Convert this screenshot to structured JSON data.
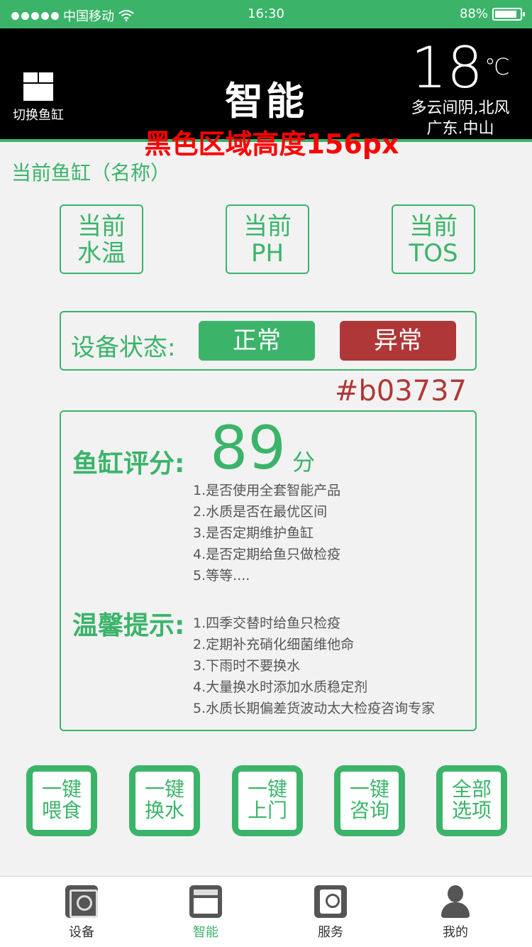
{
  "status_bar": {
    "carrier": "中国移动",
    "time": "16:30",
    "battery": "88%"
  },
  "header": {
    "switch_label": "切换鱼缸",
    "title": "智能",
    "temperature": "18",
    "temperature_unit": "℃",
    "weather_desc": "多云间阴,北风",
    "location": "广东.中山"
  },
  "annotations": {
    "header_note": "黑色区域高度156px",
    "color_note": "#b03737"
  },
  "tank_name": "当前鱼缸（名称）",
  "metrics": [
    {
      "line1": "当前",
      "line2": "水温"
    },
    {
      "line1": "当前",
      "line2": "PH"
    },
    {
      "line1": "当前",
      "line2": "TOS"
    }
  ],
  "device_status": {
    "label": "设备状态:",
    "normal": "正常",
    "abnormal": "异常"
  },
  "score": {
    "label": "鱼缸评分:",
    "value": "89",
    "unit": "分",
    "criteria": [
      "1.是否使用全套智能产品",
      "2.水质是否在最优区间",
      "3.是否定期维护鱼缸",
      "4.是否定期给鱼只做检疫",
      "5.等等...."
    ]
  },
  "tips": {
    "label": "温馨提示:",
    "items": [
      "1.四季交替时给鱼只检疫",
      "2.定期补充硝化细菌维他命",
      "3.下雨时不要换水",
      "4.大量换水时添加水质稳定剂",
      "5.水质长期偏差货波动太大检疫咨询专家"
    ]
  },
  "actions": [
    {
      "line1": "一键",
      "line2": "喂食"
    },
    {
      "line1": "一键",
      "line2": "换水"
    },
    {
      "line1": "一键",
      "line2": "上门"
    },
    {
      "line1": "一键",
      "line2": "咨询"
    },
    {
      "line1": "全部",
      "line2": "选项"
    }
  ],
  "tabbar": [
    {
      "label": "设备",
      "icon": "device-icon"
    },
    {
      "label": "智能",
      "icon": "smart-icon",
      "active": true
    },
    {
      "label": "服务",
      "icon": "service-icon"
    },
    {
      "label": "我的",
      "icon": "profile-icon"
    }
  ],
  "colors": {
    "accent": "#3bb46a",
    "danger": "#b03737",
    "header_bg": "#000000"
  }
}
